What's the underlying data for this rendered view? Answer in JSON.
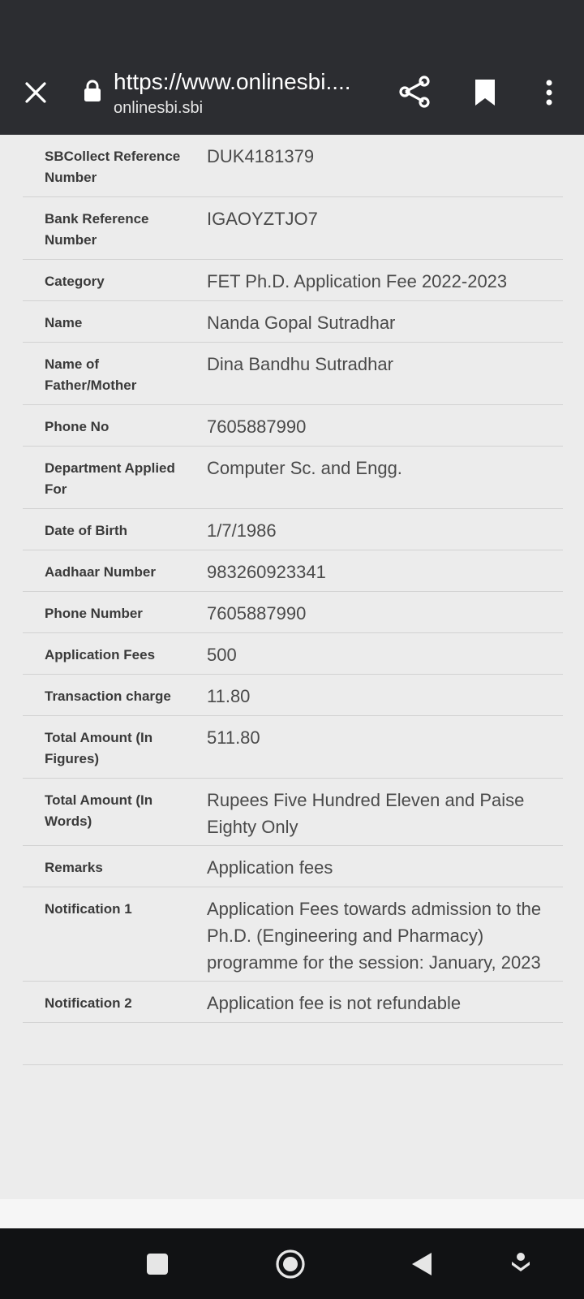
{
  "browser": {
    "url": "https://www.onlinesbi....",
    "domain": "onlinesbi.sbi",
    "icons": {
      "close": "close-icon",
      "lock": "lock-icon",
      "share": "share-icon",
      "bookmark": "bookmark-icon",
      "menu": "more-vert-icon"
    }
  },
  "receipt": {
    "rows": [
      {
        "label": "SBCollect Reference Number",
        "value": "DUK4181379"
      },
      {
        "label": "Bank Reference Number",
        "value": "IGAOYZTJO7"
      },
      {
        "label": "Category",
        "value": "FET Ph.D. Application Fee 2022-2023"
      },
      {
        "label": "Name",
        "value": "Nanda Gopal Sutradhar"
      },
      {
        "label": "Name of Father/Mother",
        "value": "Dina Bandhu Sutradhar"
      },
      {
        "label": "Phone No",
        "value": "7605887990"
      },
      {
        "label": "Department Applied For",
        "value": "Computer Sc. and Engg."
      },
      {
        "label": "Date of Birth",
        "value": "1/7/1986"
      },
      {
        "label": "Aadhaar Number",
        "value": "983260923341"
      },
      {
        "label": "Phone Number",
        "value": "7605887990"
      },
      {
        "label": "Application Fees",
        "value": "500"
      },
      {
        "label": "Transaction charge",
        "value": "11.80"
      },
      {
        "label": "Total Amount (In Figures)",
        "value": "511.80"
      },
      {
        "label": "Total Amount (In Words)",
        "value": "Rupees Five Hundred Eleven and Paise Eighty Only"
      },
      {
        "label": "Remarks",
        "value": "Application fees"
      },
      {
        "label": "Notification 1",
        "value": "Application Fees towards admission to the Ph.D. (Engineering and Pharmacy) programme for the session: January, 2023"
      },
      {
        "label": "Notification 2",
        "value": "Application fee is not refundable"
      }
    ]
  },
  "navbar": {
    "icons": [
      "recent-apps-icon",
      "home-icon",
      "back-icon",
      "keyboard-hide-icon"
    ]
  }
}
